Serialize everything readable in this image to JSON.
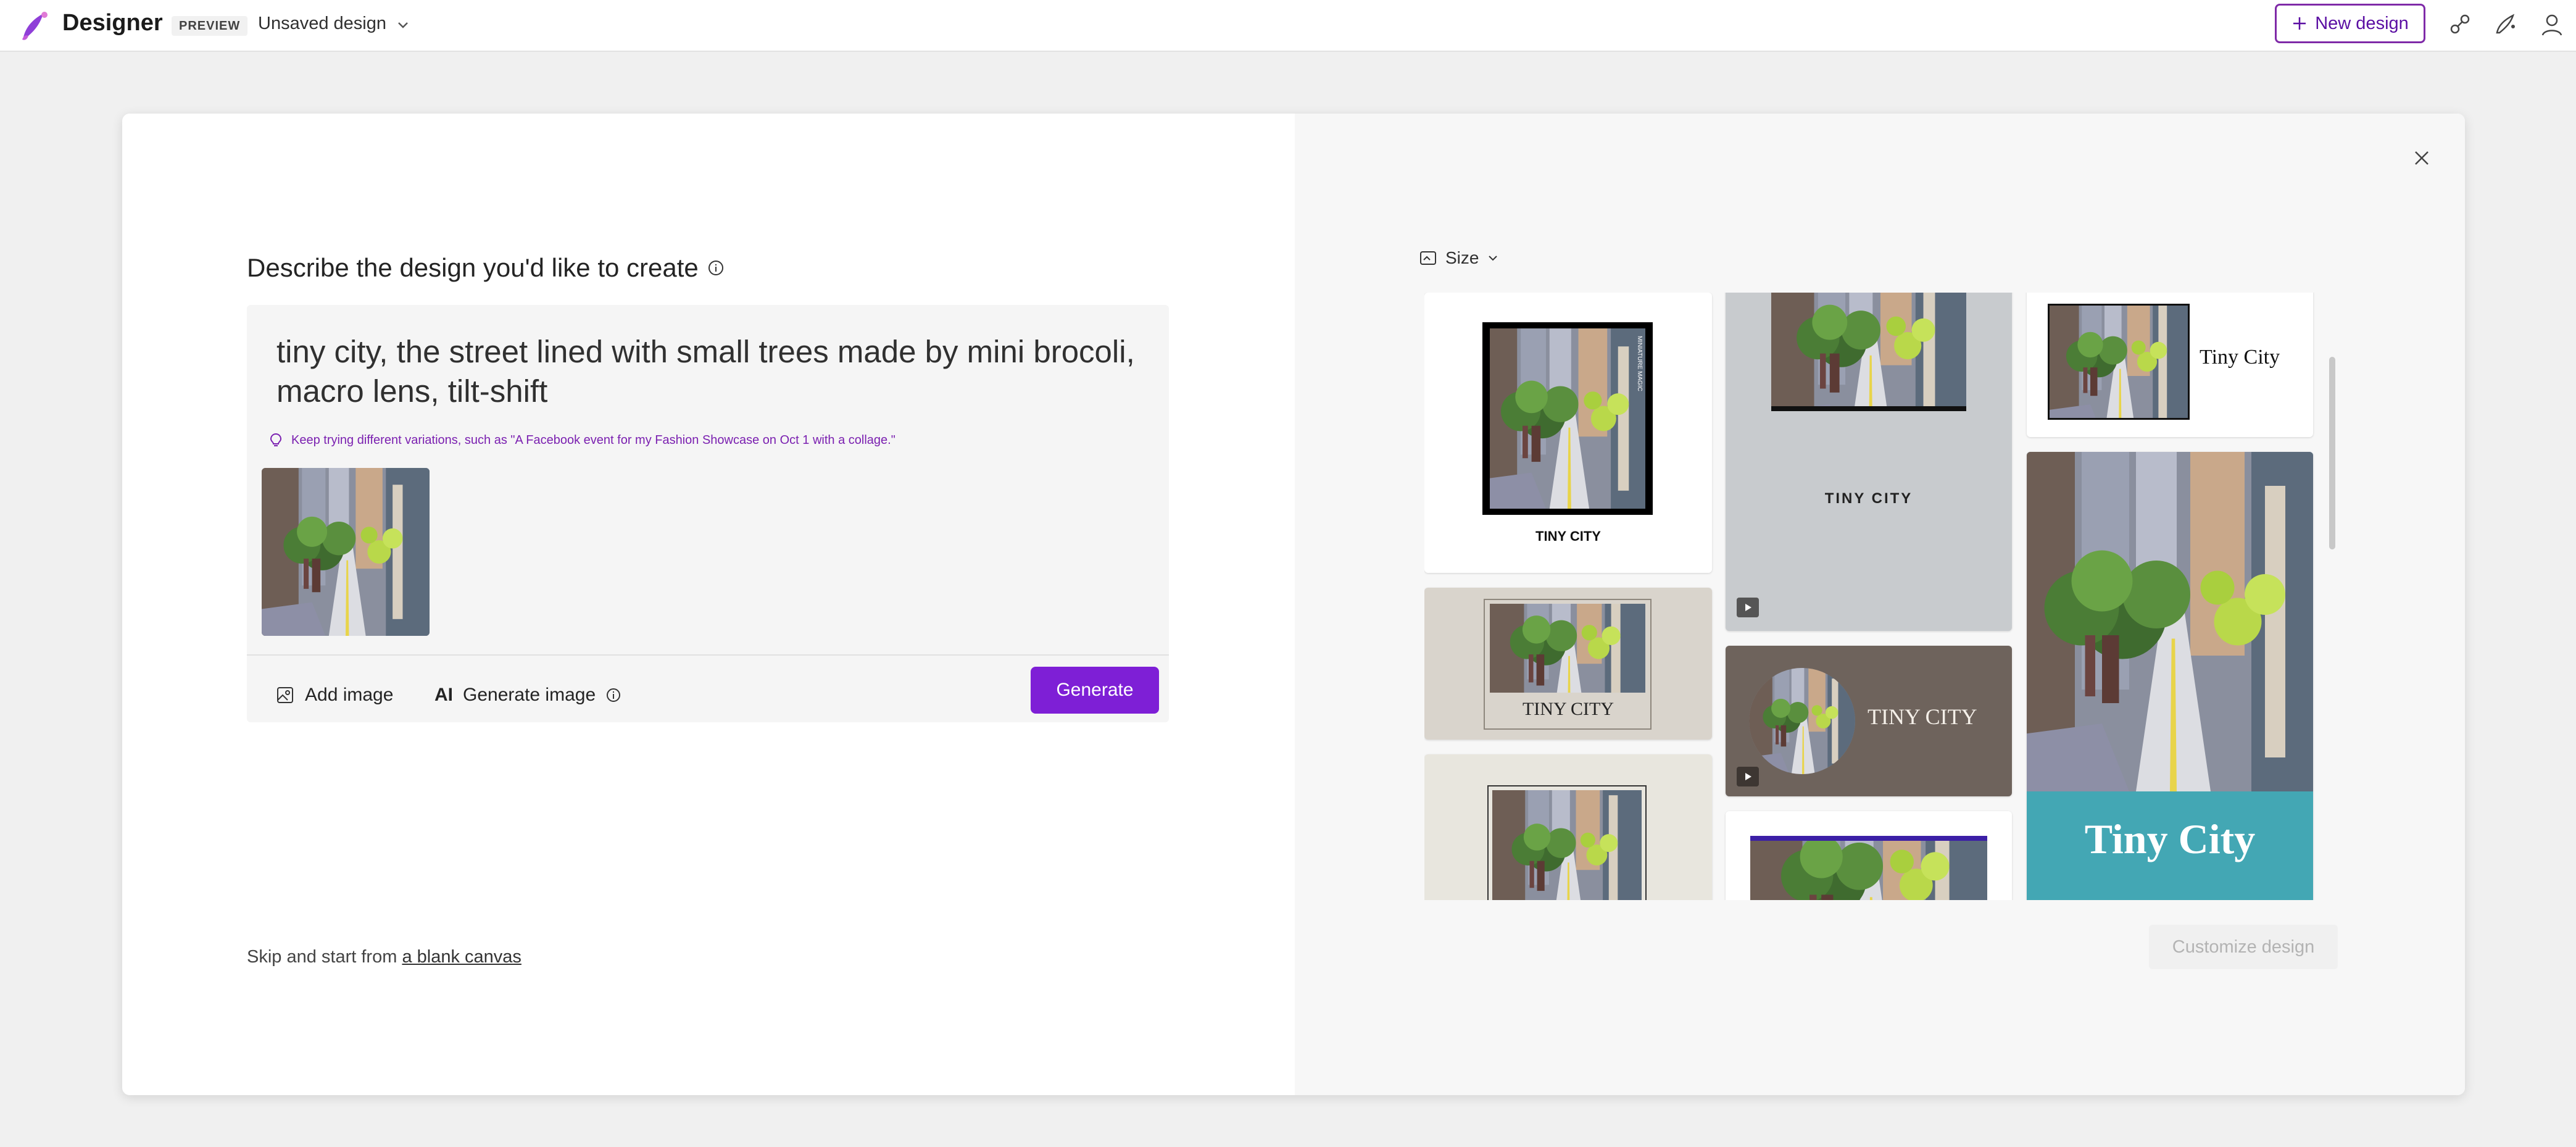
{
  "app": {
    "name": "Designer",
    "badge": "PREVIEW",
    "document_name": "Unsaved design"
  },
  "header": {
    "new_design_label": "New design"
  },
  "icons": {
    "logo": "designer-logo-icon",
    "chevron": "chevron-down-icon",
    "plus": "plus-icon",
    "share": "share-icon",
    "designer_apps": "paint-brush-icon",
    "account": "account-icon",
    "info": "info-icon",
    "lightbulb": "lightbulb-icon",
    "add_image": "image-add-icon",
    "ai": "ai-icon",
    "close": "close-icon",
    "size": "size-icon",
    "video": "video-icon"
  },
  "colors": {
    "accent": "#7e1fd6",
    "accent_border": "#7f2aa8",
    "tip": "#7a1fb0",
    "teal": "#43a7b4"
  },
  "describe": {
    "heading": "Describe the design you'd like to create",
    "prompt": "tiny city, the street lined with small trees made by mini brocoli, macro lens, tilt-shift",
    "tip": "Keep trying different variations, such as \"A Facebook event for my Fashion Showcase on Oct 1 with a collage.\"",
    "add_image_label": "Add image",
    "generate_image_label": "Generate image",
    "generate_label": "Generate"
  },
  "skip": {
    "prefix": "Skip and start from ",
    "link": "a blank canvas"
  },
  "gallery": {
    "size_label": "Size",
    "customize_label": "Customize design",
    "cards": [
      {
        "title": "TINY CITY",
        "side_text": "MINIATURE MAGIC"
      },
      {
        "title": "TINY CITY"
      },
      {
        "title": "TINY CITY"
      },
      {
        "title": "TINY CITY"
      },
      {
        "title": "Tiny City"
      },
      {
        "title": "Tiny City"
      }
    ]
  }
}
